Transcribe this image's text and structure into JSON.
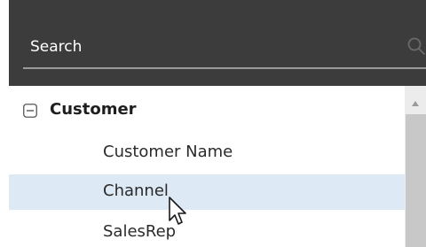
{
  "search": {
    "placeholder": "Search",
    "icon": "search-icon"
  },
  "tree": {
    "group": {
      "label": "Customer",
      "expanded": true,
      "toggle_icon": "collapse-icon"
    },
    "items": [
      {
        "label": "Customer Name"
      },
      {
        "label": "Channel",
        "hovered": true
      },
      {
        "label": "SalesRep"
      }
    ]
  },
  "colors": {
    "header_background": "#3c3c3c",
    "hover_row": "#dde9f4",
    "scroll_thumb": "#c8c8c8"
  }
}
